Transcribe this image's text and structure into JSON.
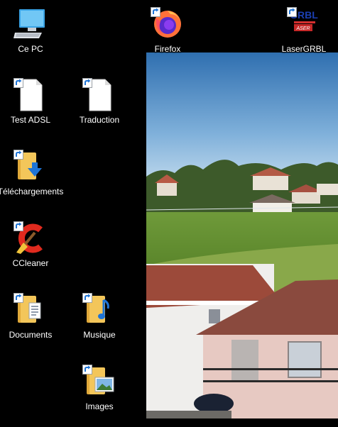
{
  "desktop": {
    "icons": [
      {
        "label": "Ce PC",
        "icon": "computer-icon"
      },
      {
        "label": "Firefox",
        "icon": "firefox-icon"
      },
      {
        "label": "LaserGRBL",
        "icon": "lasergrbl-icon",
        "logo_text": "GRBL"
      },
      {
        "label": "Test ADSL",
        "icon": "file-icon"
      },
      {
        "label": "Traduction",
        "icon": "file-icon"
      },
      {
        "label": "Téléchargements",
        "icon": "downloads-folder-icon"
      },
      {
        "label": "CCleaner",
        "icon": "ccleaner-icon"
      },
      {
        "label": "Documents",
        "icon": "documents-folder-icon"
      },
      {
        "label": "Musique",
        "icon": "music-folder-icon"
      },
      {
        "label": "Images",
        "icon": "pictures-folder-icon"
      }
    ]
  },
  "colors": {
    "background": "#000000",
    "label_text": "#ffffff",
    "folder_yellow": "#f3c65a",
    "shortcut_arrow": "#1e74d6"
  }
}
